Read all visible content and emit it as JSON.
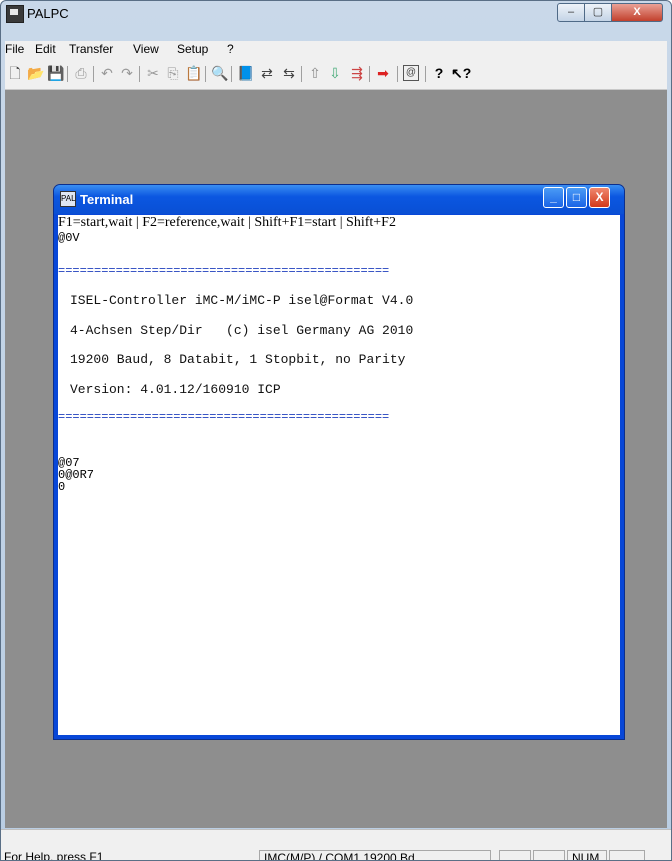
{
  "app": {
    "title": "PALPC",
    "controls": {
      "minimize": "–",
      "maximize": "▢",
      "close": "X"
    }
  },
  "menu": [
    "File",
    "Edit",
    "Transfer",
    "View",
    "Setup",
    "?"
  ],
  "toolbar": {
    "icons": [
      "new-icon",
      "open-icon",
      "save-icon",
      "print-icon",
      "undo-icon",
      "redo-icon",
      "cut-icon",
      "copy-icon",
      "paste-icon",
      "find-icon",
      "help-book-icon",
      "connect-icon",
      "transfer-icon",
      "upload-icon",
      "download-icon",
      "send-icon",
      "arrow-icon",
      "terminal-icon",
      "help-icon",
      "context-help-icon"
    ]
  },
  "terminal": {
    "title": "Terminal",
    "icon_glyph": "PAL",
    "header": "F1=start,wait | F2=reference,wait | Shift+F1=start | Shift+F2",
    "lines_top": [
      "@0V"
    ],
    "rule": "==============================================",
    "info": [
      "ISEL-Controller iMC-M/iMC-P isel@Format V4.0",
      "4-Achsen Step/Dir   (c) isel Germany AG 2010",
      "19200 Baud, 8 Databit, 1 Stopbit, no Parity",
      "Version: 4.01.12/160910 ICP"
    ],
    "lines_bottom": [
      "@07",
      "0@0R7",
      "0"
    ],
    "controls": {
      "minimize": "_",
      "maximize": "□",
      "close": "X"
    }
  },
  "status": {
    "help": "For Help, press F1",
    "connection": "IMC(M/P) / COM1 19200 Bd",
    "num": "NUM"
  },
  "colors": {
    "client_area": "#8e8e8e",
    "terminal_title": "#0b57e1",
    "rule": "#1f3fbd"
  }
}
